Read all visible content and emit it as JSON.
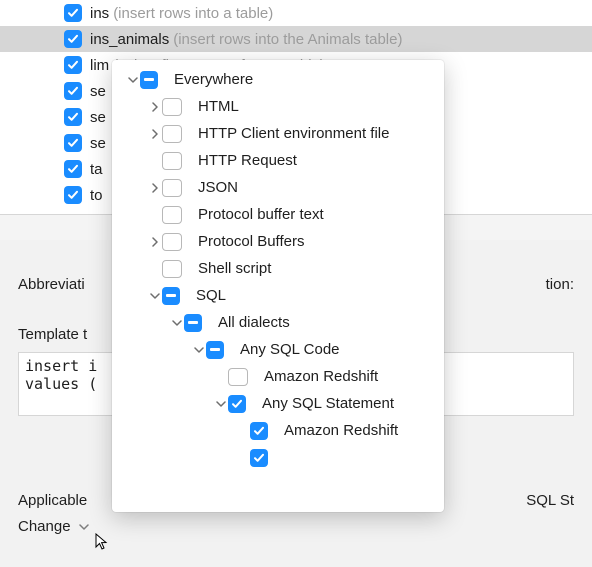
{
  "templates": [
    {
      "name": "ins",
      "desc": "(insert rows into a table)"
    },
    {
      "name": "ins_animals",
      "desc": "(insert rows into the Animals table)"
    },
    {
      "name": "lim",
      "desc": "(select first N rows from a table)"
    },
    {
      "name": "se"
    },
    {
      "name": "se"
    },
    {
      "name": "se"
    },
    {
      "name": "ta"
    },
    {
      "name": "to"
    }
  ],
  "detail": {
    "abbreviation_label": "Abbreviati",
    "description_tail": "tion:",
    "template_text_label": "Template t",
    "truncated_ble": "ble)",
    "code_line1": "insert i",
    "code_line2": "values (",
    "applicable_label": "Applicable",
    "context_tail": "SQL St",
    "change_label": "Change"
  },
  "tree": {
    "everywhere": "Everywhere",
    "html": "HTML",
    "http_env": "HTTP Client environment file",
    "http_request": "HTTP Request",
    "json": "JSON",
    "protobuf_text": "Protocol buffer text",
    "protobuf": "Protocol Buffers",
    "shell": "Shell script",
    "sql": "SQL",
    "all_dialects": "All dialects",
    "any_sql_code": "Any SQL Code",
    "redshift": "Amazon Redshift",
    "any_sql_statement": "Any SQL Statement"
  }
}
